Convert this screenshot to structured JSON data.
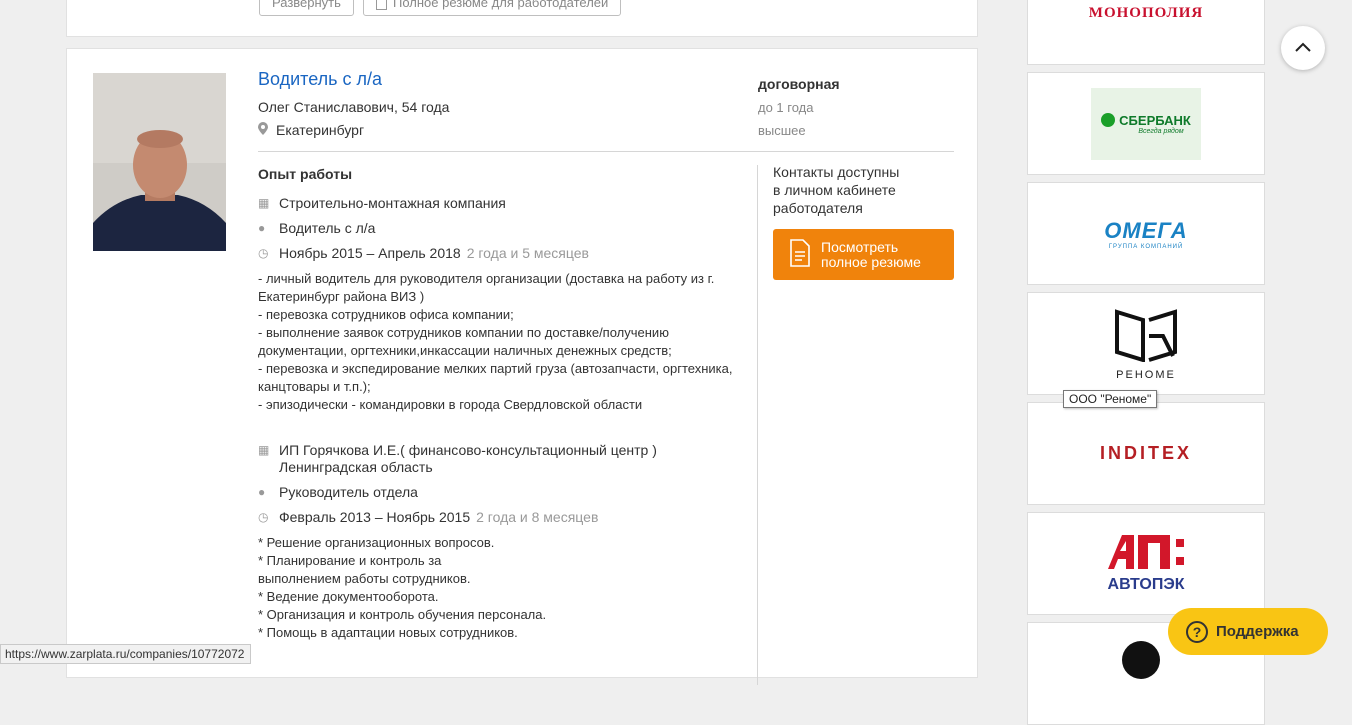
{
  "prev_card": {
    "expand_label": "Развернуть",
    "full_resume_label": "Полное резюме для работодателей"
  },
  "resume": {
    "title": "Водитель с л/а",
    "person": "Олег Станиславович, 54 года",
    "city": "Екатеринбург",
    "salary": "договорная",
    "experience": "до 1 года",
    "education": "высшее",
    "work_heading": "Опыт работы",
    "jobs": [
      {
        "company": "Строительно-монтажная компания",
        "position": "Водитель с л/а",
        "period": "Ноябрь 2015 – Апрель 2018",
        "duration": "2 года и 5 месяцев",
        "description": "- личный водитель для руководителя организации (доставка на работу из г. Екатеринбург района ВИЗ )\n- перевозка сотрудников офиса компании;\n- выполнение заявок сотрудников компании по доставке/получению документации, оргтехники,инкассации наличных денежных средств;\n- перевозка и экспедирование мелких партий груза (автозапчасти, оргтехника, канцтовары и т.п.);\n- эпизодически - командировки в города Свердловской области"
      },
      {
        "company": "ИП Горячкова И.Е.( финансово-консультационный центр ) Ленинградская область",
        "position": "Руководитель отдела",
        "period": "Февраль 2013 – Ноябрь 2015",
        "duration": "2 года и 8 месяцев",
        "description": "* Решение организационных вопросов.\n* Планирование и контроль за\nвыполнением работы сотрудников.\n* Ведение документооборота.\n* Организация и контроль обучения персонала.\n* Помощь в адаптации новых сотрудников."
      }
    ],
    "contacts_text": "Контакты доступны\nв личном кабинете\nработодателя",
    "view_button": "Посмотреть\nполное резюме"
  },
  "sidebar": {
    "logos": [
      {
        "name": "МОНОПОЛИЯ",
        "color": "#c8102e"
      },
      {
        "name": "СБЕРБАНК",
        "sub": "Всегда рядом",
        "color": "#1a9f29"
      },
      {
        "name": "ОМЕГА",
        "sub": "ГРУППА КОМПАНИЙ",
        "color": "#1a82c4"
      },
      {
        "name": "РЕНОМЕ",
        "color": "#222222"
      },
      {
        "name": "INDITEX",
        "color": "#b51f24"
      },
      {
        "name": "АВТОПЭК",
        "color": "#2a3c8c"
      }
    ],
    "tooltip": "ООО \"Реноме\""
  },
  "support_label": "Поддержка",
  "status_url": "https://www.zarplata.ru/companies/10772072",
  "colors": {
    "link": "#1a66c2",
    "button": "#f0830c",
    "support": "#f9c514"
  }
}
